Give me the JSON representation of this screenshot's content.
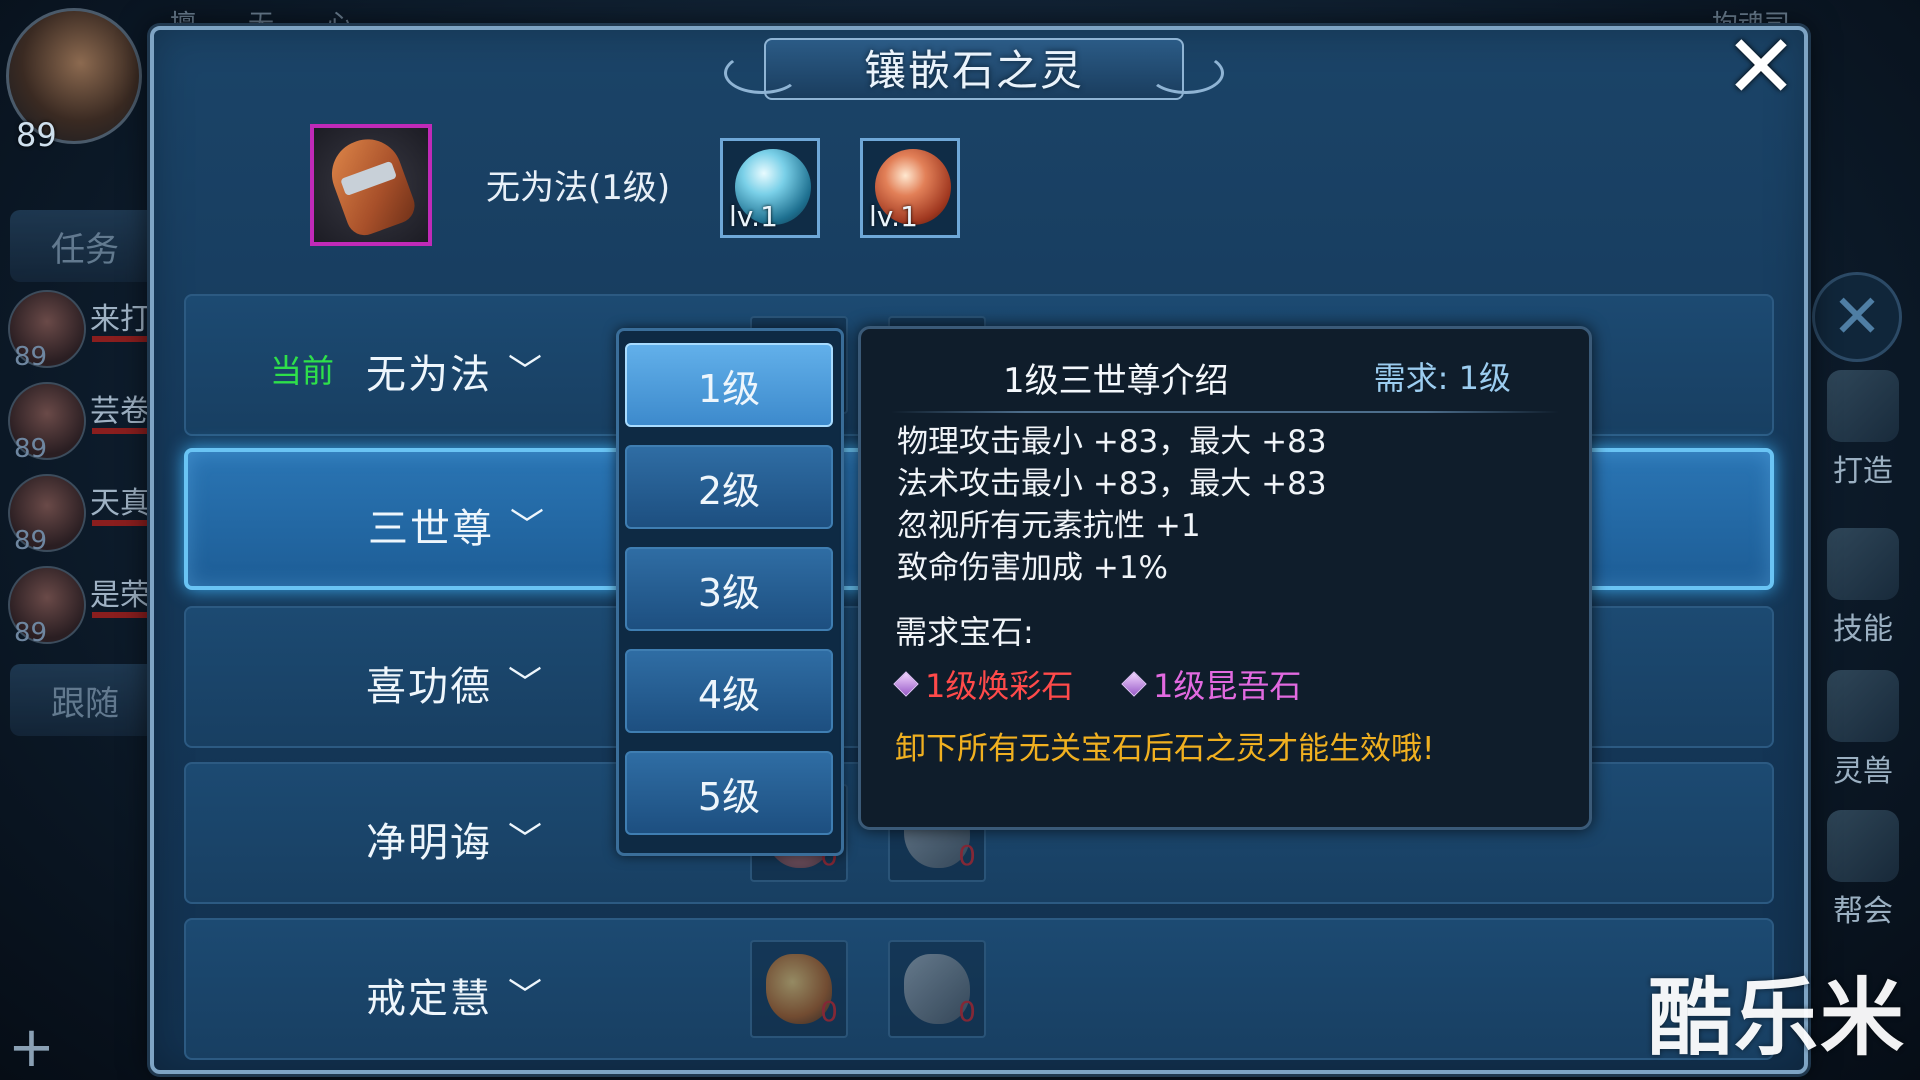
{
  "hud": {
    "player_level": "89",
    "task_label": "任务",
    "follow_label": "跟随",
    "top_left_text": "擅……无……心",
    "top_right_text": "拘魂司",
    "party": [
      {
        "name": "来打",
        "level": "89"
      },
      {
        "name": "芸卷",
        "level": "89"
      },
      {
        "name": "天真",
        "level": "89"
      },
      {
        "name": "是荣",
        "level": "89"
      }
    ],
    "side_buttons": [
      {
        "label": "打造",
        "icon": "hammer-icon"
      },
      {
        "label": "技能",
        "icon": "skill-book-icon"
      },
      {
        "label": "灵兽",
        "icon": "pet-icon"
      },
      {
        "label": "帮会",
        "icon": "guild-scroll-icon"
      }
    ],
    "watermark": "酷乐米"
  },
  "dialog": {
    "title": "镶嵌石之灵",
    "equipment": {
      "name": "无为法(1级)",
      "icon": "glove-icon",
      "gems": [
        {
          "level": "lv.1",
          "color": "#5fc4e4"
        },
        {
          "level": "lv.1",
          "color": "#d0603a"
        }
      ]
    },
    "current_label": "当前",
    "rows": [
      {
        "name": "无为法",
        "is_current": true
      },
      {
        "name": "三世尊",
        "selected": true
      },
      {
        "name": "喜功德"
      },
      {
        "name": "净明诲",
        "slot_counts": [
          "0",
          "0"
        ]
      },
      {
        "name": "戒定慧",
        "slot_counts": [
          "0",
          "0"
        ]
      }
    ],
    "level_dropdown": {
      "selected": "1级",
      "options": [
        "1级",
        "2级",
        "3级",
        "4级",
        "5级"
      ]
    },
    "tooltip": {
      "title": "1级三世尊介绍",
      "requirement": "需求: 1级",
      "stats": [
        "物理攻击最小 +83，最大 +83",
        "法术攻击最小 +83，最大 +83",
        "忽视所有元素抗性 +1",
        "致命伤害加成 +1%"
      ],
      "gems_label": "需求宝石:",
      "required_gems": [
        {
          "name": "1级焕彩石",
          "color": "#ff4a4a"
        },
        {
          "name": "1级昆吾石",
          "color": "#e26ae0"
        }
      ],
      "warning": "卸下所有无关宝石后石之灵才能生效哦!"
    }
  }
}
